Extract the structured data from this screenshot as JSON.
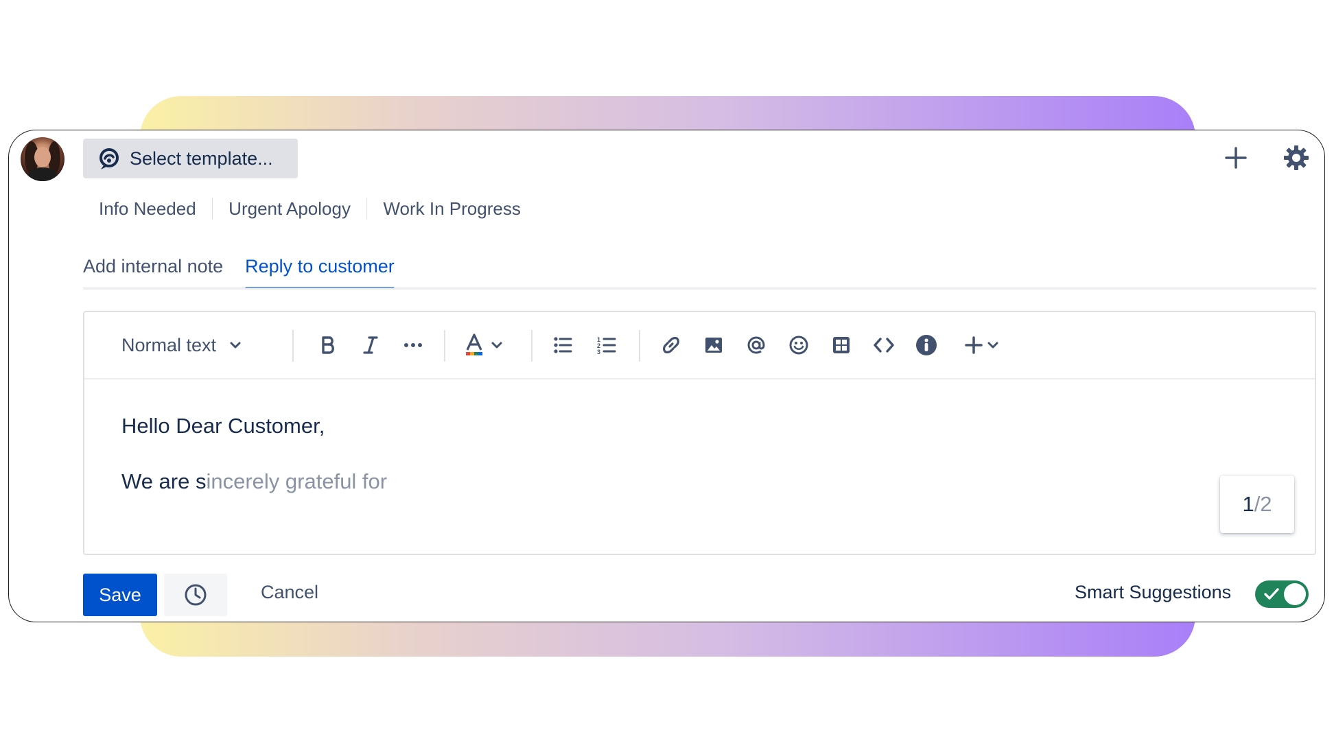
{
  "header": {
    "template_label": "Select template...",
    "add_icon": "plus-icon",
    "settings_icon": "gear-icon"
  },
  "quick_templates": [
    "Info Needed",
    "Urgent Apology",
    "Work In Progress"
  ],
  "tabs": [
    {
      "label": "Add internal note",
      "active": false
    },
    {
      "label": "Reply to customer",
      "active": true
    }
  ],
  "toolbar": {
    "text_style": "Normal text",
    "icons": [
      "bold-icon",
      "italic-icon",
      "more-icon",
      "text-color-icon",
      "bullet-list-icon",
      "numbered-list-icon",
      "link-icon",
      "image-icon",
      "mention-icon",
      "emoji-icon",
      "table-icon",
      "code-icon",
      "info-icon",
      "insert-icon"
    ]
  },
  "editor": {
    "line1": "Hello Dear Customer,",
    "line2_typed": "We are s",
    "line2_suggestion": "incerely grateful for",
    "suggestion_index": "1",
    "suggestion_total": "/2"
  },
  "footer": {
    "save_label": "Save",
    "cancel_label": "Cancel",
    "smart_suggestions_label": "Smart Suggestions",
    "smart_suggestions_enabled": true
  },
  "colors": {
    "primary": "#0052cc",
    "toggle_on": "#1f845a",
    "text": "#172b4d",
    "subtle_text": "#42526e",
    "ghost_text": "#8993a4"
  }
}
